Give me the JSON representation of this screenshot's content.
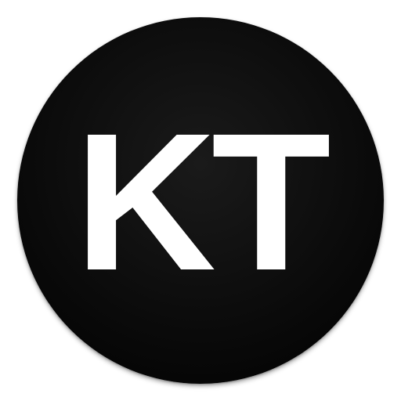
{
  "icon": {
    "monogram": "KT",
    "background_color": "#000000",
    "text_color": "#ffffff",
    "shape": "circle"
  }
}
